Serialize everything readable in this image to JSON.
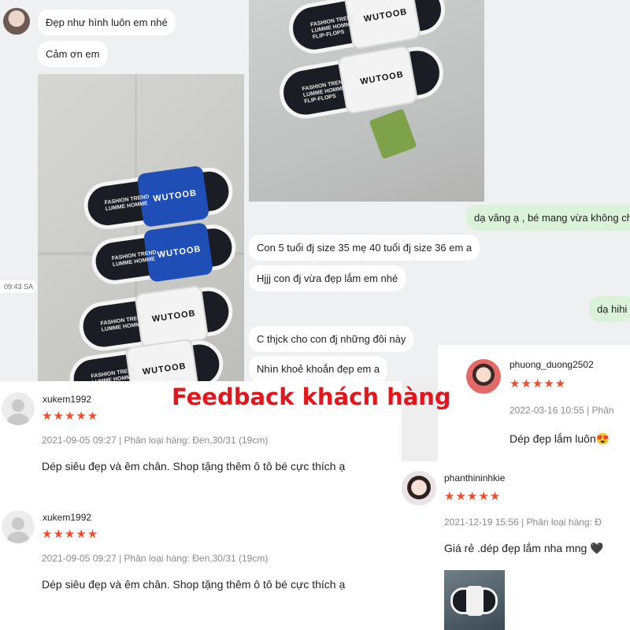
{
  "chat": {
    "incoming": [
      "Đẹp như hình luôn em nhé",
      "Cảm ơn em",
      "Con 5 tuổi đj size 35 mẹ 40 tuổi đj size 36 em a",
      "Hjjj con đj vừa đẹp lắm em nhé",
      "C thjck cho con đj những đôi này",
      "Nhìn khoẻ khoắn đẹp em a"
    ],
    "outgoing": [
      "dạ vâng ạ , bé mang vừa không chị",
      "dạ hihi"
    ],
    "timestamp": "09:43 SA",
    "slipper_text": {
      "brand_line1": "FASHION TREND",
      "brand_line2": "LUMME HOMME",
      "brand_line3": "FLIP-FLOPS",
      "logo": "WUTOOB"
    }
  },
  "headline": "Feedback khách hàng",
  "reviews": [
    {
      "user": "xukem1992",
      "stars": "★★★★★",
      "meta": "2021-09-05 09:27 | Phân loại hàng: Đen,30/31 (19cm)",
      "comment": "Dép siêu đẹp và êm chân. Shop tặng thêm ô tô bé cực thích ạ"
    },
    {
      "user": "xukem1992",
      "stars": "★★★★★",
      "meta": "2021-09-05 09:27 | Phân loại hàng: Đen,30/31 (19cm)",
      "comment": "Dép siêu đẹp và êm chân. Shop tặng thêm ô tô bé cực thích ạ"
    },
    {
      "user": "phuong_duong2502",
      "stars": "★★★★★",
      "meta": "2022-03-16 10:55 | Phân",
      "comment": "Dép đẹp lắm luôn😍"
    },
    {
      "user": "phanthininhkie",
      "stars": "★★★★★",
      "meta": "2021-12-19 15:56 | Phân loại hàng: Đ",
      "comment": "Giá rẻ .dép đẹp lắm nha mng 🖤"
    }
  ],
  "colors": {
    "headline": "#e3161d",
    "stars": "#ee4d2d",
    "outgoing_bubble": "#d9f2d9",
    "strap_blue": "#1f4fb6"
  }
}
